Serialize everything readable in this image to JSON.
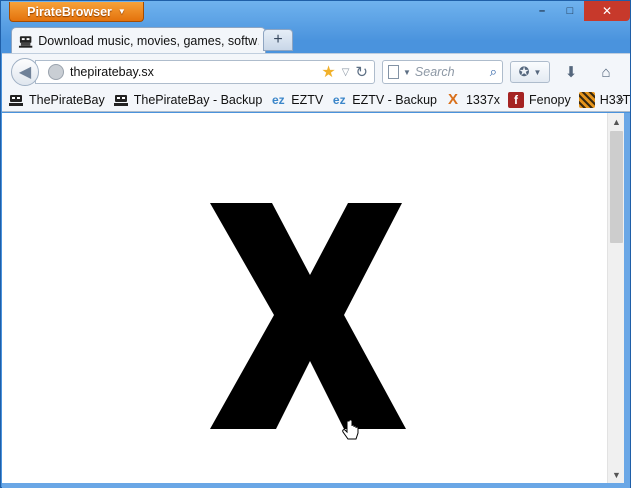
{
  "app_menu": {
    "label": "PirateBrowser"
  },
  "window_controls": {
    "minimize": "–",
    "maximize": "□",
    "close": "✕"
  },
  "tabs": [
    {
      "title": "Download music, movies, games, softw…"
    }
  ],
  "new_tab": "+",
  "navigation": {
    "url": "thepiratebay.sx",
    "search_placeholder": "Search"
  },
  "bookmarks": [
    {
      "label": "ThePirateBay",
      "icon": "pirate-ship-icon"
    },
    {
      "label": "ThePirateBay - Backup",
      "icon": "pirate-ship-icon"
    },
    {
      "label": "EZTV",
      "icon": "eztv-icon"
    },
    {
      "label": "EZTV - Backup",
      "icon": "eztv-icon"
    },
    {
      "label": "1337x",
      "icon": "1337x-icon"
    },
    {
      "label": "Fenopy",
      "icon": "fenopy-icon"
    },
    {
      "label": "H33T",
      "icon": "h33t-icon"
    }
  ],
  "bookmarks_overflow": "»",
  "colors": {
    "app_button": "#e4720c",
    "close_button": "#c7392b",
    "frame": "#4a93dd"
  }
}
